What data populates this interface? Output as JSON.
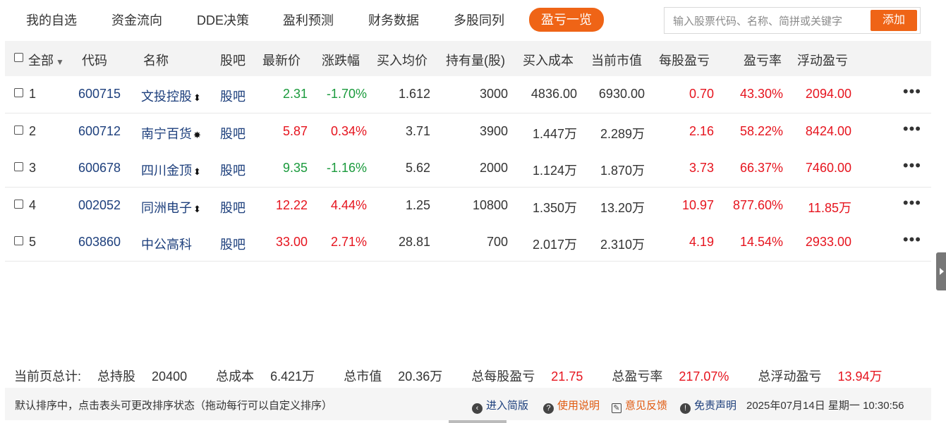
{
  "tabs": [
    {
      "label": "我的自选"
    },
    {
      "label": "资金流向"
    },
    {
      "label": "DDE决策"
    },
    {
      "label": "盈利预测"
    },
    {
      "label": "财务数据"
    },
    {
      "label": "多股同列"
    },
    {
      "label": "盈亏一览",
      "active": true
    }
  ],
  "search": {
    "placeholder": "输入股票代码、名称、简拼或关键字",
    "value": "",
    "button": "添加"
  },
  "table": {
    "headers": {
      "all": "全部",
      "code": "代码",
      "name": "名称",
      "bar": "股吧",
      "price": "最新价",
      "change": "涨跌幅",
      "avg_buy": "买入均价",
      "holding": "持有量(股)",
      "cost": "买入成本",
      "value": "当前市值",
      "per_share": "每股盈亏",
      "rate": "盈亏率",
      "float": "浮动盈亏"
    },
    "rows": [
      {
        "idx": "1",
        "code": "600715",
        "name": "文投控股",
        "mark": "⬍",
        "bar": "股吧",
        "price": "2.31",
        "change": "-1.70%",
        "avg_buy": "1.612",
        "holding": "3000",
        "cost": "4836.00",
        "value": "6930.00",
        "per_share": "0.70",
        "rate": "43.30%",
        "float": "2094.00"
      },
      {
        "idx": "2",
        "code": "600712",
        "name": "南宁百货",
        "mark": "✸",
        "bar": "股吧",
        "price": "5.87",
        "change": "0.34%",
        "avg_buy": "3.71",
        "holding": "3900",
        "cost": "1.447万",
        "value": "2.289万",
        "per_share": "2.16",
        "rate": "58.22%",
        "float": "8424.00"
      },
      {
        "idx": "3",
        "code": "600678",
        "name": "四川金顶",
        "mark": "⬍",
        "bar": "股吧",
        "price": "9.35",
        "change": "-1.16%",
        "avg_buy": "5.62",
        "holding": "2000",
        "cost": "1.124万",
        "value": "1.870万",
        "per_share": "3.73",
        "rate": "66.37%",
        "float": "7460.00"
      },
      {
        "idx": "4",
        "code": "002052",
        "name": "同洲电子",
        "mark": "⬍",
        "bar": "股吧",
        "price": "12.22",
        "change": "4.44%",
        "avg_buy": "1.25",
        "holding": "10800",
        "cost": "1.350万",
        "value": "13.20万",
        "per_share": "10.97",
        "rate": "877.60%",
        "float": "11.85万"
      },
      {
        "idx": "5",
        "code": "603860",
        "name": "中公高科",
        "mark": "",
        "bar": "股吧",
        "price": "33.00",
        "change": "2.71%",
        "avg_buy": "28.81",
        "holding": "700",
        "cost": "2.017万",
        "value": "2.310万",
        "per_share": "4.19",
        "rate": "14.54%",
        "float": "2933.00"
      }
    ]
  },
  "summary": {
    "prefix": "当前页总计:",
    "total_holding_label": "总持股",
    "total_holding": "20400",
    "total_cost_label": "总成本",
    "total_cost": "6.421万",
    "total_value_label": "总市值",
    "total_value": "20.36万",
    "per_share_label": "总每股盈亏",
    "per_share": "21.75",
    "rate_label": "总盈亏率",
    "rate": "217.07%",
    "float_label": "总浮动盈亏",
    "float": "13.94万"
  },
  "footer": {
    "note": "默认排序中，点击表头可更改排序状态（拖动每行可以自定义排序）",
    "simple": "进入简版",
    "help": "使用说明",
    "feedback": "意见反馈",
    "disclaimer": "免责声明",
    "datetime": "2025年07月14日 星期一 10:30:56"
  },
  "colors": {
    "accent": "#ef6416",
    "up": "#e6141e",
    "down": "#1a9a3c",
    "link": "#1d3f7c"
  }
}
